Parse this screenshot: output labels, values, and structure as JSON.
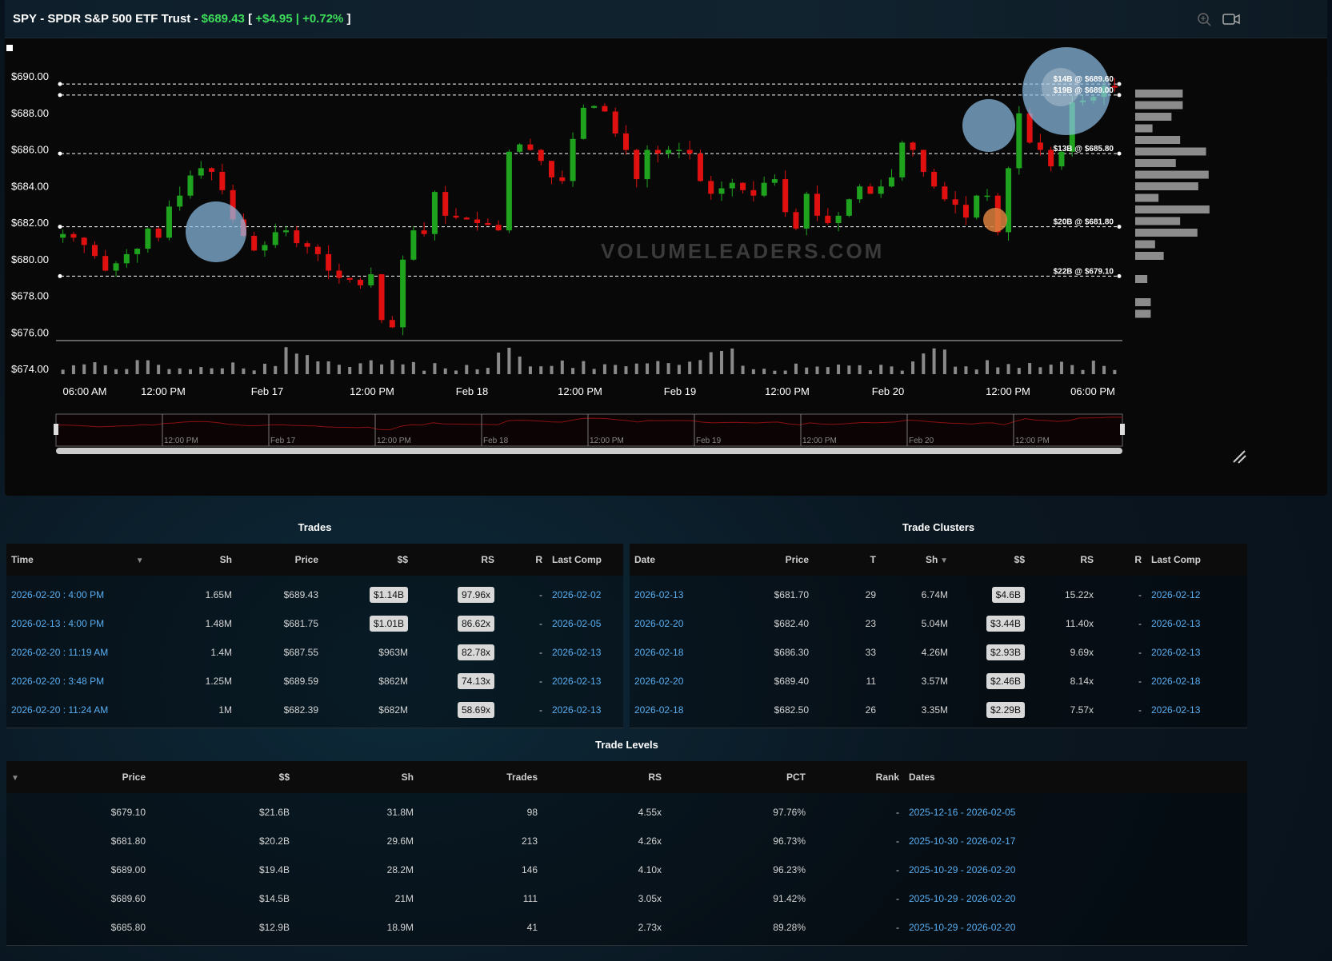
{
  "header": {
    "ticker": "SPY",
    "name": "SPDR S&P 500 ETF Trust",
    "price": "$689.43",
    "change": "+$4.95",
    "change_pct": "+0.72%",
    "bracket_open": "[",
    "bracket_close": "]",
    "separator": "|",
    "dash": "-"
  },
  "watermark": "VOLUMELEADERS.COM",
  "chart_data": {
    "type": "candlestick",
    "y_axis_ticks": [
      "$690.00",
      "$688.00",
      "$686.00",
      "$684.00",
      "$682.00",
      "$680.00",
      "$678.00",
      "$676.00",
      "$674.00"
    ],
    "y_range": [
      674,
      690
    ],
    "x_axis_ticks": [
      "06:00 AM",
      "12:00 PM",
      "Feb 17",
      "12:00 PM",
      "Feb 18",
      "12:00 PM",
      "Feb 19",
      "12:00 PM",
      "Feb 20",
      "12:00 PM",
      "06:00 PM"
    ],
    "navigator_ticks": [
      "12:00 PM",
      "Feb 17",
      "12:00 PM",
      "Feb 18",
      "12:00 PM",
      "Feb 19",
      "12:00 PM",
      "Feb 20",
      "12:00 PM"
    ],
    "levels": [
      {
        "label": "$14B @ $689.60",
        "price": 689.6
      },
      {
        "label": "$19B @ $689.00",
        "price": 689.0
      },
      {
        "label": "$13B @ $685.80",
        "price": 685.8
      },
      {
        "label": "$20B @ $681.80",
        "price": 681.8
      },
      {
        "label": "$22B @ $679.10",
        "price": 679.1
      }
    ],
    "closes": [
      681.4,
      681.2,
      680.8,
      680.2,
      679.4,
      679.8,
      680.3,
      680.6,
      681.7,
      681.2,
      682.9,
      683.5,
      684.6,
      685.0,
      684.8,
      683.8,
      682.2,
      681.3,
      680.5,
      680.8,
      681.5,
      681.6,
      680.9,
      680.7,
      680.3,
      679.4,
      679.0,
      678.9,
      678.6,
      679.2,
      676.7,
      676.3,
      680.0,
      681.6,
      681.4,
      683.7,
      682.4,
      682.3,
      682.2,
      682.0,
      681.9,
      681.6,
      685.9,
      686.3,
      686.0,
      685.4,
      684.5,
      684.3,
      686.6,
      688.3,
      688.4,
      688.1,
      686.9,
      686.0,
      684.4,
      686.0,
      685.8,
      686.0,
      686.0,
      685.8,
      684.3,
      683.6,
      683.9,
      684.2,
      683.8,
      683.5,
      684.2,
      684.4,
      682.6,
      681.7,
      683.6,
      682.4,
      682.0,
      682.4,
      683.3,
      684.0,
      683.6,
      684.0,
      684.5,
      686.4,
      686.0,
      684.8,
      684.0,
      683.3,
      683.0,
      682.3,
      683.5,
      683.5,
      681.5,
      685.0,
      688.0,
      686.4,
      686.0,
      685.1,
      685.9,
      688.6,
      688.7,
      688.9,
      689.5,
      689.4
    ],
    "volume_profile": [
      0.55,
      0.55,
      0.42,
      0.2,
      0.52,
      0.82,
      0.47,
      0.85,
      0.73,
      0.27,
      0.86,
      0.52,
      0.72,
      0.23,
      0.33,
      0,
      0.14,
      0,
      0.18,
      0.18
    ]
  },
  "trades": {
    "title": "Trades",
    "columns": [
      "Time",
      "Sh",
      "Price",
      "$$",
      "RS",
      "R",
      "Last Comp"
    ],
    "rows": [
      {
        "time": "2026-02-20 : 4:00 PM",
        "sh": "1.65M",
        "price": "$689.43",
        "dollars": "$1.14B",
        "rs": "97.96x",
        "r": "-",
        "last": "2026-02-02",
        "pill": true
      },
      {
        "time": "2026-02-13 : 4:00 PM",
        "sh": "1.48M",
        "price": "$681.75",
        "dollars": "$1.01B",
        "rs": "86.62x",
        "r": "-",
        "last": "2026-02-05",
        "pill": true
      },
      {
        "time": "2026-02-20 : 11:19 AM",
        "sh": "1.4M",
        "price": "$687.55",
        "dollars": "$963M",
        "rs": "82.78x",
        "r": "-",
        "last": "2026-02-13",
        "pill": false
      },
      {
        "time": "2026-02-20 : 3:48 PM",
        "sh": "1.25M",
        "price": "$689.59",
        "dollars": "$862M",
        "rs": "74.13x",
        "r": "-",
        "last": "2026-02-13",
        "pill": false
      },
      {
        "time": "2026-02-20 : 11:24 AM",
        "sh": "1M",
        "price": "$682.39",
        "dollars": "$682M",
        "rs": "58.69x",
        "r": "-",
        "last": "2026-02-13",
        "pill": false
      }
    ]
  },
  "clusters": {
    "title": "Trade Clusters",
    "columns": [
      "Date",
      "Price",
      "T",
      "Sh",
      "$$",
      "RS",
      "R",
      "Last Comp"
    ],
    "rows": [
      {
        "date": "2026-02-13",
        "price": "$681.70",
        "t": "29",
        "sh": "6.74M",
        "dollars": "$4.6B",
        "rs": "15.22x",
        "r": "-",
        "last": "2026-02-12"
      },
      {
        "date": "2026-02-20",
        "price": "$682.40",
        "t": "23",
        "sh": "5.04M",
        "dollars": "$3.44B",
        "rs": "11.40x",
        "r": "-",
        "last": "2026-02-13"
      },
      {
        "date": "2026-02-18",
        "price": "$686.30",
        "t": "33",
        "sh": "4.26M",
        "dollars": "$2.93B",
        "rs": "9.69x",
        "r": "-",
        "last": "2026-02-13"
      },
      {
        "date": "2026-02-20",
        "price": "$689.40",
        "t": "11",
        "sh": "3.57M",
        "dollars": "$2.46B",
        "rs": "8.14x",
        "r": "-",
        "last": "2026-02-18"
      },
      {
        "date": "2026-02-18",
        "price": "$682.50",
        "t": "26",
        "sh": "3.35M",
        "dollars": "$2.29B",
        "rs": "7.57x",
        "r": "-",
        "last": "2026-02-13"
      }
    ]
  },
  "levels_table": {
    "title": "Trade Levels",
    "columns": [
      "Price",
      "$$",
      "Sh",
      "Trades",
      "RS",
      "PCT",
      "Rank",
      "Dates"
    ],
    "rows": [
      {
        "price": "$679.10",
        "dollars": "$21.6B",
        "sh": "31.8M",
        "trades": "98",
        "rs": "4.55x",
        "pct": "97.76%",
        "rank": "-",
        "dates": "2025-12-16 - 2026-02-05"
      },
      {
        "price": "$681.80",
        "dollars": "$20.2B",
        "sh": "29.6M",
        "trades": "213",
        "rs": "4.26x",
        "pct": "96.73%",
        "rank": "-",
        "dates": "2025-10-30 - 2026-02-17"
      },
      {
        "price": "$689.00",
        "dollars": "$19.4B",
        "sh": "28.2M",
        "trades": "146",
        "rs": "4.10x",
        "pct": "96.23%",
        "rank": "-",
        "dates": "2025-10-29 - 2026-02-20"
      },
      {
        "price": "$689.60",
        "dollars": "$14.5B",
        "sh": "21M",
        "trades": "111",
        "rs": "3.05x",
        "pct": "91.42%",
        "rank": "-",
        "dates": "2025-10-29 - 2026-02-20"
      },
      {
        "price": "$685.80",
        "dollars": "$12.9B",
        "sh": "18.9M",
        "trades": "41",
        "rs": "2.73x",
        "pct": "89.28%",
        "rank": "-",
        "dates": "2025-10-29 - 2026-02-20"
      }
    ]
  },
  "icons": {
    "zoom": "zoom-icon",
    "video": "video-icon",
    "resize": "resize-icon"
  },
  "colors": {
    "up": "#1fa31f",
    "down": "#e01010",
    "accent_green": "#3ddc5a",
    "link": "#5aaef0"
  }
}
